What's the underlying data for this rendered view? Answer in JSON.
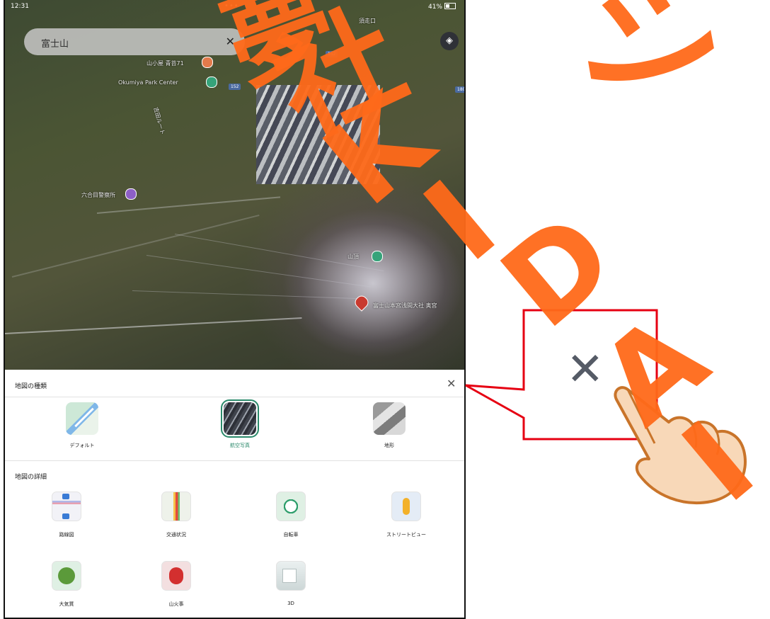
{
  "status_bar": {
    "time": "12:31",
    "dots": "•••",
    "battery": "41%"
  },
  "search": {
    "query": "富士山",
    "clear_icon": "✕"
  },
  "layers_button": {
    "icon": "layers-icon",
    "glyph": "◈"
  },
  "map": {
    "labels": {
      "hut_top": "山小屋 青苔71",
      "english_label": "Okumiya Park Center",
      "trail": "吉田ルート",
      "mid_label": "六合目警察所",
      "summit_label": "山頂",
      "summit_detail": "富士山本宮浅間大社 奥宮",
      "top_right": "須走口"
    },
    "route_badges": [
      "152",
      "152",
      "180"
    ]
  },
  "sheet": {
    "map_type_title": "地図の種類",
    "close_icon": "✕",
    "map_types": [
      {
        "label": "デフォルト",
        "selected": false
      },
      {
        "label": "航空写真",
        "selected": true
      },
      {
        "label": "地形",
        "selected": false
      }
    ],
    "details_title": "地図の詳細",
    "details": [
      {
        "label": "路線図"
      },
      {
        "label": "交通状況"
      },
      {
        "label": "自転車"
      },
      {
        "label": "ストリートビュー"
      },
      {
        "label": "大気質"
      },
      {
        "label": "山火事"
      },
      {
        "label": "3D"
      }
    ]
  },
  "annotation": {
    "close_glyph": "✕"
  },
  "watermark": {
    "chars": [
      "夢",
      "シ",
      "社",
      "K",
      "I",
      "D",
      "A",
      "I"
    ],
    "color": "#ff6a1a"
  }
}
